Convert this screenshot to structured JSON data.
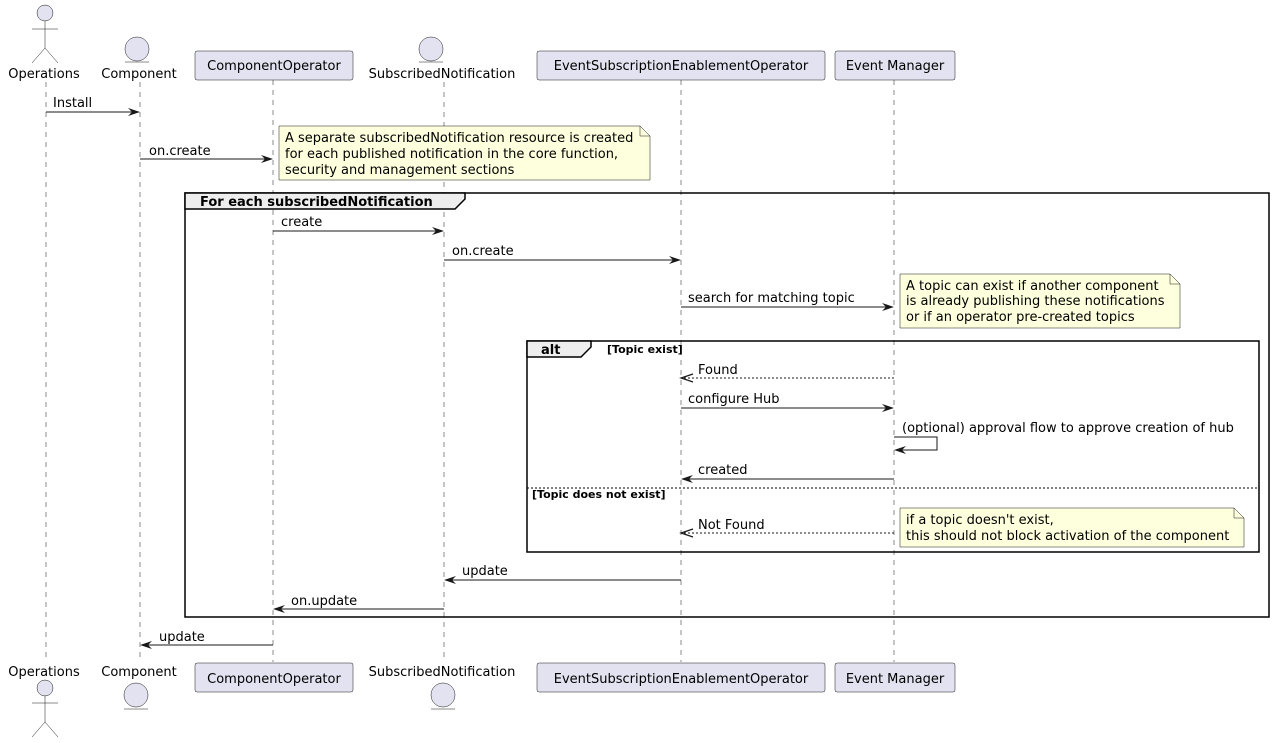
{
  "diagram": {
    "type": "sequence",
    "participants": [
      {
        "id": "ops",
        "label": "Operations",
        "kind": "actor"
      },
      {
        "id": "comp",
        "label": "Component",
        "kind": "entity"
      },
      {
        "id": "compop",
        "label": "ComponentOperator",
        "kind": "participant"
      },
      {
        "id": "subn",
        "label": "SubscribedNotification",
        "kind": "entity"
      },
      {
        "id": "eseo",
        "label": "EventSubscriptionEnablementOperator",
        "kind": "participant"
      },
      {
        "id": "em",
        "label": "Event Manager",
        "kind": "participant"
      }
    ],
    "messages": [
      {
        "from": "ops",
        "to": "comp",
        "label": "Install",
        "style": "solid"
      },
      {
        "from": "comp",
        "to": "compop",
        "label": "on.create",
        "style": "solid"
      },
      {
        "from": "compop",
        "to": "subn",
        "label": "create",
        "style": "solid"
      },
      {
        "from": "subn",
        "to": "eseo",
        "label": "on.create",
        "style": "solid"
      },
      {
        "from": "eseo",
        "to": "em",
        "label": "search for matching topic",
        "style": "solid"
      },
      {
        "from": "em",
        "to": "eseo",
        "label": "Found",
        "style": "dashed"
      },
      {
        "from": "eseo",
        "to": "em",
        "label": "configure Hub",
        "style": "solid"
      },
      {
        "from": "em",
        "to": "em",
        "label": "(optional) approval flow to approve creation of hub",
        "style": "solid"
      },
      {
        "from": "em",
        "to": "eseo",
        "label": "created",
        "style": "solid"
      },
      {
        "from": "em",
        "to": "eseo",
        "label": "Not Found",
        "style": "dashed"
      },
      {
        "from": "eseo",
        "to": "subn",
        "label": "update",
        "style": "solid"
      },
      {
        "from": "subn",
        "to": "compop",
        "label": "on.update",
        "style": "solid"
      },
      {
        "from": "compop",
        "to": "comp",
        "label": "update",
        "style": "solid"
      }
    ],
    "notes": [
      {
        "lines": [
          "A separate subscribedNotification resource is created",
          "for each published notification in the core function,",
          "security and management sections"
        ]
      },
      {
        "lines": [
          "A topic can exist if another component",
          "is already publishing these notifications",
          "or if an operator pre-created topics"
        ]
      },
      {
        "lines": [
          "if a topic doesn't exist,",
          "this should not block activation of the component"
        ]
      }
    ],
    "frames": {
      "loop": {
        "title": "For each subscribedNotification"
      },
      "alt": {
        "title": "alt",
        "guard1": "[Topic exist]",
        "guard2": "[Topic does not exist]"
      }
    }
  }
}
